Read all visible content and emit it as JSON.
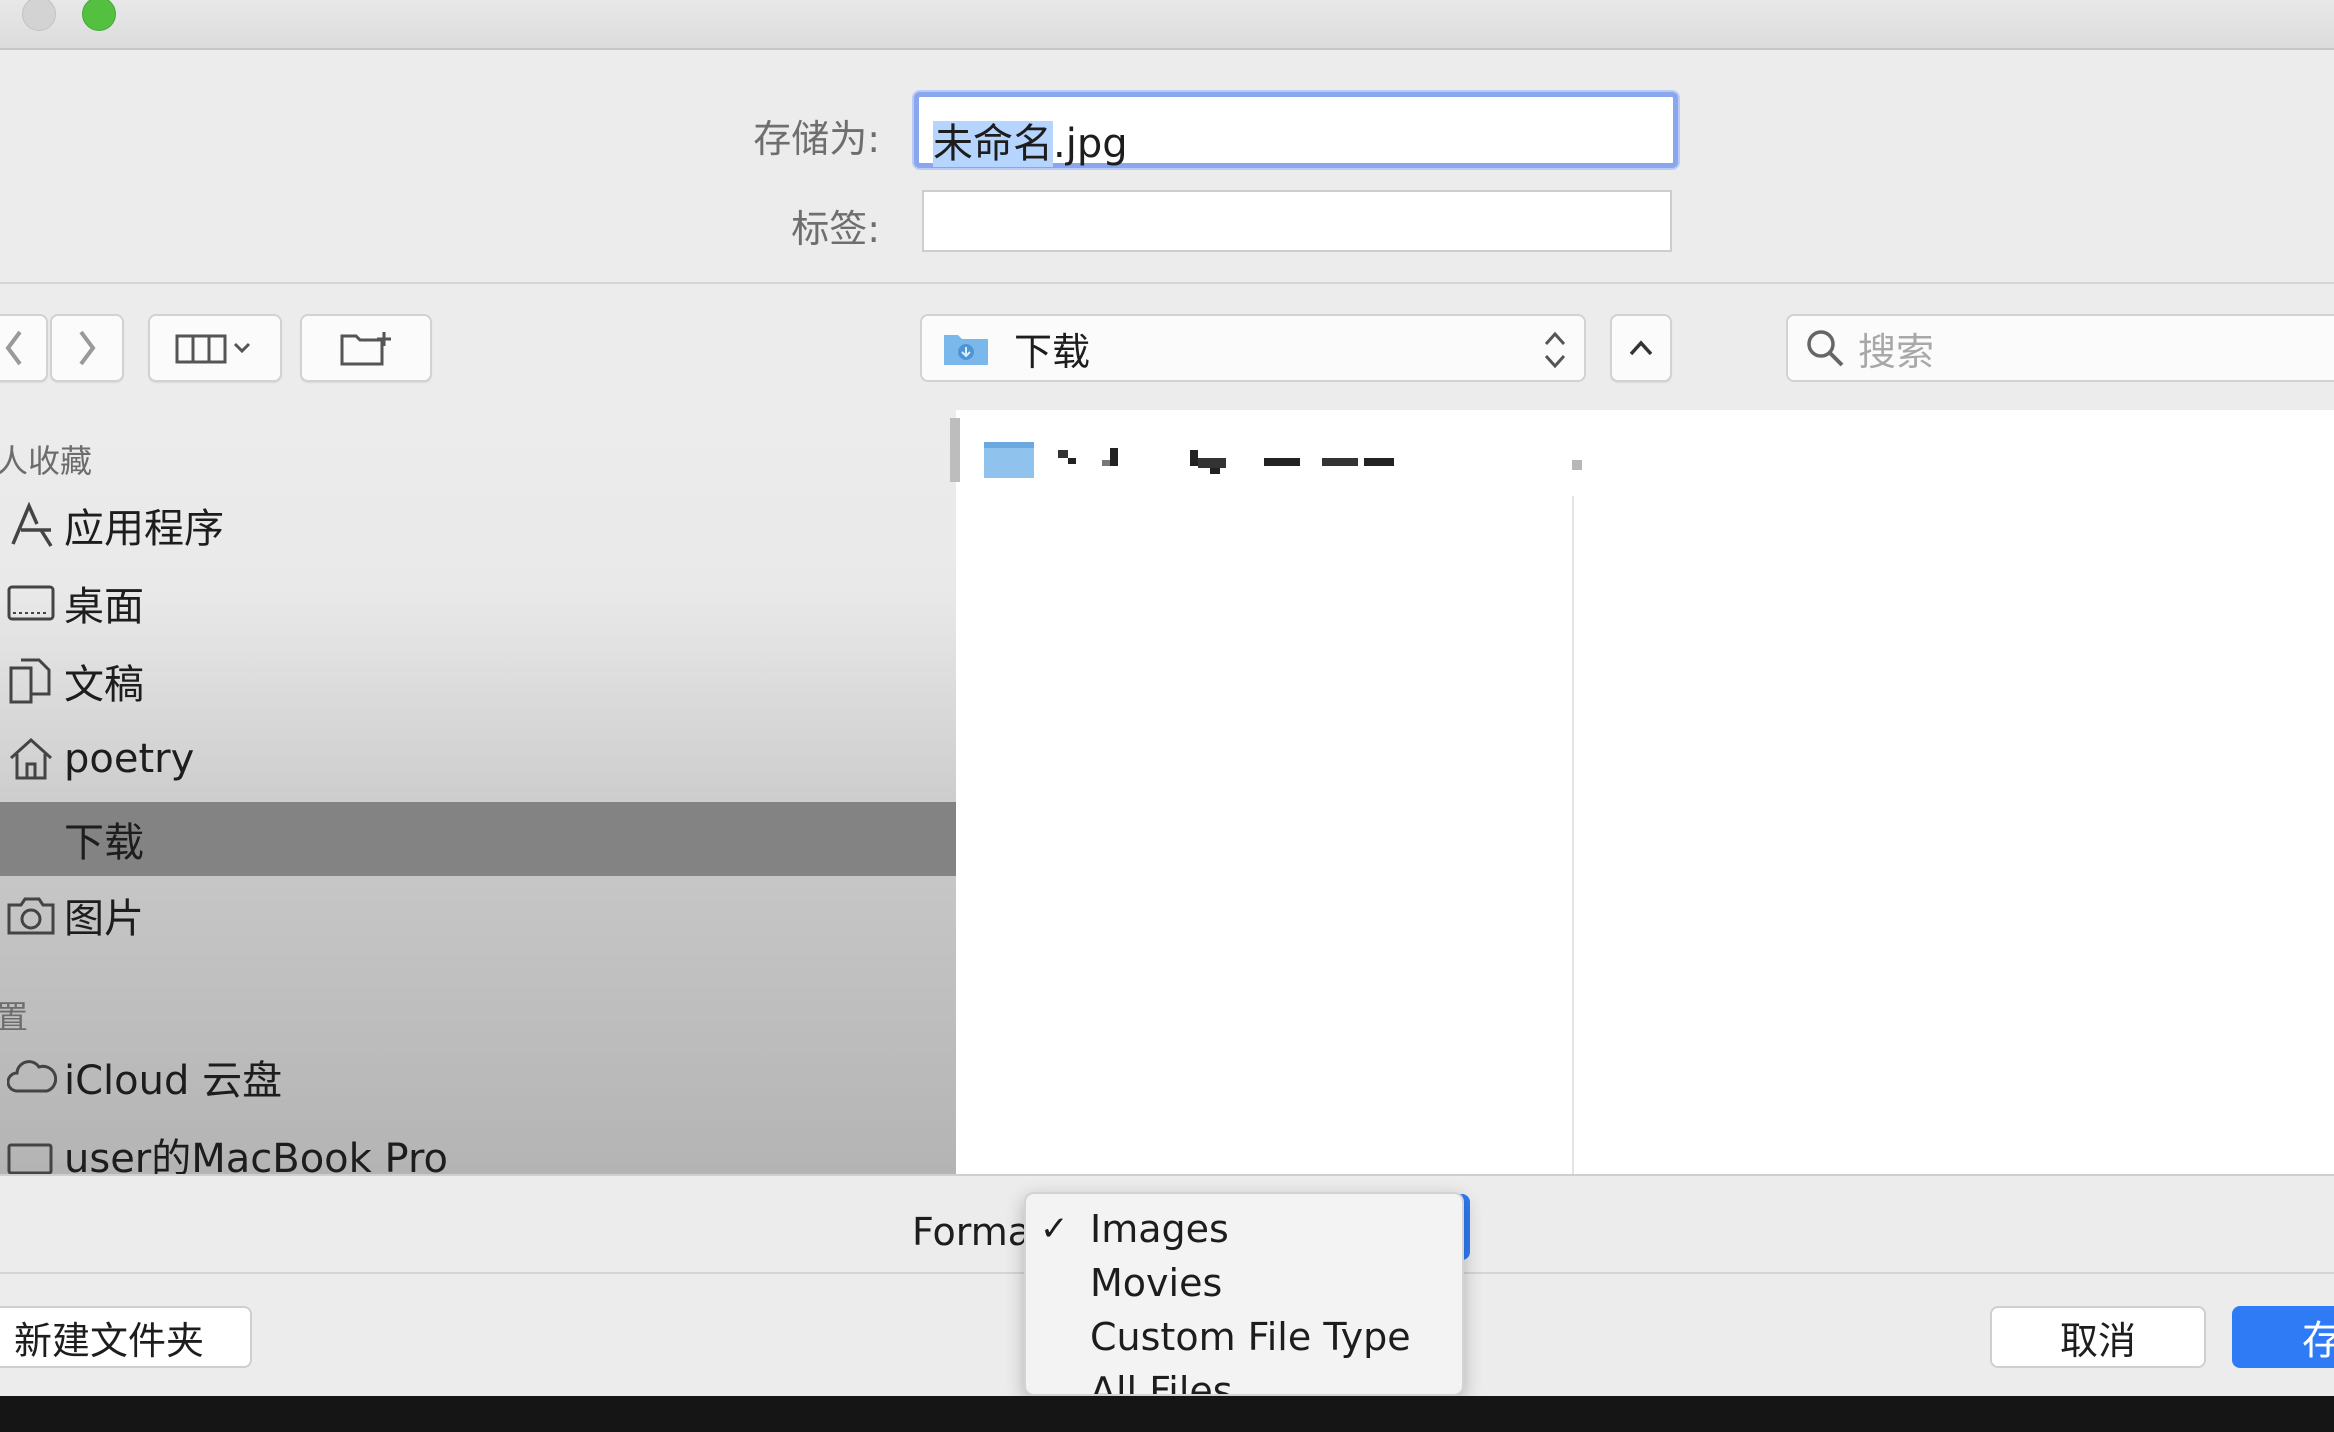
{
  "form": {
    "saveas_label": "存储为:",
    "filename_selected": "未命名",
    "filename_ext": ".jpg",
    "tags_label": "标签:",
    "tags_value": ""
  },
  "toolbar": {
    "location": "下载",
    "search_placeholder": "搜索"
  },
  "sidebar": {
    "favorites_title": "人收藏",
    "locations_title": "置",
    "items": [
      {
        "label": "应用程序",
        "icon": "applications-icon"
      },
      {
        "label": "桌面",
        "icon": "desktop-icon"
      },
      {
        "label": "文稿",
        "icon": "documents-icon"
      },
      {
        "label": "poetry",
        "icon": "home-icon"
      },
      {
        "label": "下载",
        "icon": "downloads-icon",
        "selected": true
      },
      {
        "label": "图片",
        "icon": "camera-icon"
      }
    ],
    "locations": [
      {
        "label": "iCloud 云盘",
        "icon": "cloud-icon"
      },
      {
        "label": "user的MacBook Pro",
        "icon": "laptop-icon"
      }
    ]
  },
  "bottom": {
    "format_label": "Format",
    "format_options": [
      {
        "label": "Images",
        "checked": true
      },
      {
        "label": "Movies"
      },
      {
        "label": "Custom File Type"
      },
      {
        "label": "All Files"
      }
    ],
    "new_folder": "新建文件夹",
    "cancel": "取消",
    "save": "存"
  },
  "colors": {
    "accent": "#2f7bf5",
    "selection": "#838383",
    "focus_ring": "#8aa7ee"
  }
}
